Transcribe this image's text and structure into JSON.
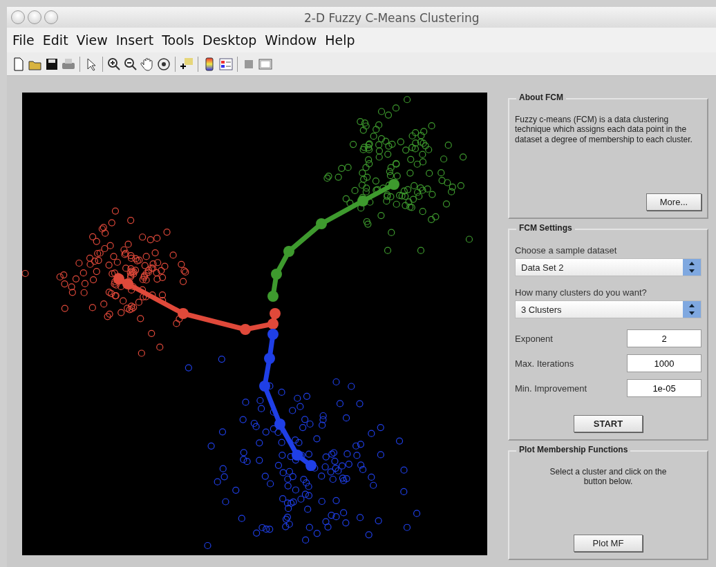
{
  "window": {
    "title": "2-D Fuzzy C-Means Clustering"
  },
  "menu": [
    "File",
    "Edit",
    "View",
    "Insert",
    "Tools",
    "Desktop",
    "Window",
    "Help"
  ],
  "toolbar": [
    {
      "kind": "new"
    },
    {
      "kind": "open"
    },
    {
      "kind": "save"
    },
    {
      "kind": "print"
    },
    {
      "kind": "sep"
    },
    {
      "kind": "pointer"
    },
    {
      "kind": "sep"
    },
    {
      "kind": "zoomin"
    },
    {
      "kind": "zoomout"
    },
    {
      "kind": "pan"
    },
    {
      "kind": "rotate"
    },
    {
      "kind": "sep"
    },
    {
      "kind": "cursor"
    },
    {
      "kind": "sep"
    },
    {
      "kind": "colorbar"
    },
    {
      "kind": "legend"
    },
    {
      "kind": "sep"
    },
    {
      "kind": "square"
    },
    {
      "kind": "frame"
    }
  ],
  "plot": {
    "clusters": [
      {
        "color": "#e0493a"
      },
      {
        "color": "#3e9a2e"
      },
      {
        "color": "#1f3fe6"
      }
    ]
  },
  "about": {
    "title": "About FCM",
    "text": "Fuzzy c-means (FCM) is a data clustering technique which assigns each data point in the dataset a degree of membership to each cluster.",
    "button": "More..."
  },
  "settings": {
    "title": "FCM Settings",
    "dataset_label": "Choose a sample dataset",
    "dataset": "Data Set 2",
    "clusters_label": "How many clusters do you want?",
    "clusters": "3 Clusters",
    "fields": [
      {
        "label": "Exponent",
        "value": "2"
      },
      {
        "label": "Max. Iterations",
        "value": "1000"
      },
      {
        "label": "Min. Improvement",
        "value": "1e-05"
      }
    ],
    "button": "START"
  },
  "membership": {
    "title": "Plot Membership Functions",
    "text": "Select a cluster and click on the button below.",
    "button": "Plot MF"
  }
}
